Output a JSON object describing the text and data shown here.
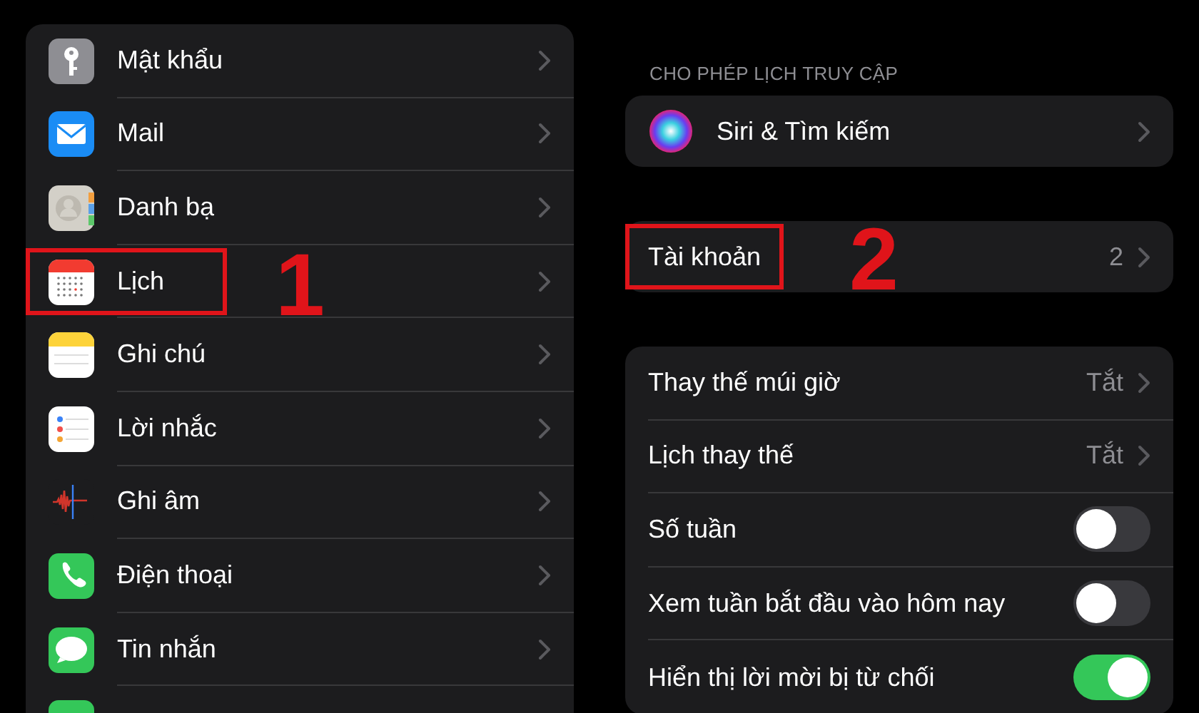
{
  "apps_list": [
    {
      "label": "Mật khẩu",
      "highlighted": false
    },
    {
      "label": "Mail",
      "highlighted": false
    },
    {
      "label": "Danh bạ",
      "highlighted": false
    },
    {
      "label": "Lịch",
      "highlighted": true,
      "callout": "1"
    },
    {
      "label": "Ghi chú",
      "highlighted": false
    },
    {
      "label": "Lời nhắc",
      "highlighted": false
    },
    {
      "label": "Ghi âm",
      "highlighted": false
    },
    {
      "label": "Điện thoại",
      "highlighted": false
    },
    {
      "label": "Tin nhắn",
      "highlighted": false
    }
  ],
  "calendar_settings": {
    "section_header": "CHO PHÉP LỊCH TRUY CẬP",
    "groups": [
      [
        {
          "kind": "siri",
          "label": "Siri & Tìm kiếm",
          "highlighted": false
        }
      ],
      [
        {
          "kind": "link",
          "label": "Tài khoản",
          "value": "2",
          "highlighted": true,
          "callout": "2"
        }
      ],
      [
        {
          "kind": "link",
          "label": "Thay thế múi giờ",
          "value": "Tắt",
          "highlighted": false
        },
        {
          "kind": "link",
          "label": "Lịch thay thế",
          "value": "Tắt",
          "highlighted": false
        },
        {
          "kind": "toggle",
          "label": "Số tuần",
          "on": false,
          "highlighted": false
        },
        {
          "kind": "toggle",
          "label": "Xem tuần bắt đầu vào hôm nay",
          "on": false,
          "highlighted": false
        },
        {
          "kind": "toggle",
          "label": "Hiển thị lời mời bị từ chối",
          "on": true,
          "highlighted": false
        }
      ]
    ]
  }
}
